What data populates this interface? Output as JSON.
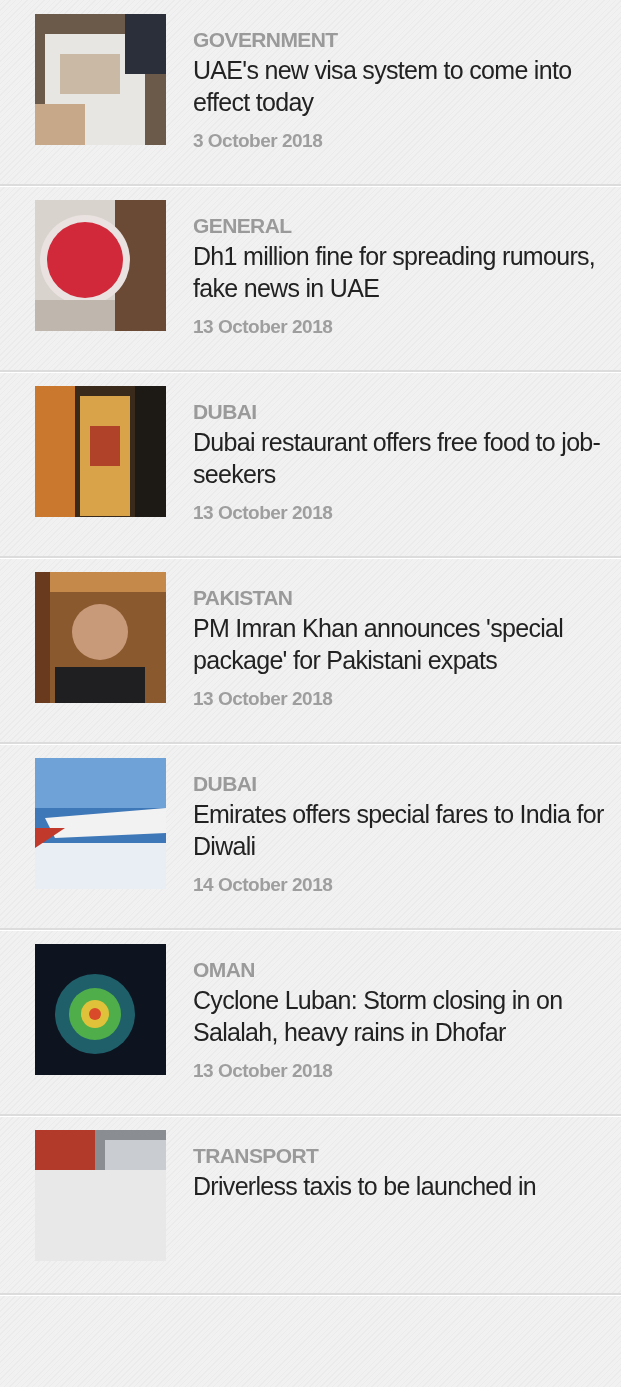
{
  "articles": [
    {
      "category": "GOVERNMENT",
      "title": "UAE's new visa system to come into effect today",
      "date": "3 October 2018"
    },
    {
      "category": "GENERAL",
      "title": "Dh1 million fine for spreading rumours, fake news in UAE",
      "date": "13 October 2018"
    },
    {
      "category": "DUBAI",
      "title": "Dubai restaurant offers free food to job-seekers",
      "date": "13 October 2018"
    },
    {
      "category": "PAKISTAN",
      "title": "PM Imran Khan announces 'special package' for Pakistani expats",
      "date": "13 October 2018"
    },
    {
      "category": "DUBAI",
      "title": "Emirates offers special fares to India for Diwali",
      "date": "14 October 2018"
    },
    {
      "category": "OMAN",
      "title": "Cyclone Luban: Storm closing in on Salalah, heavy rains in Dhofar",
      "date": "13 October 2018"
    },
    {
      "category": "TRANSPORT",
      "title": "Driverless taxis to be launched in"
    }
  ]
}
